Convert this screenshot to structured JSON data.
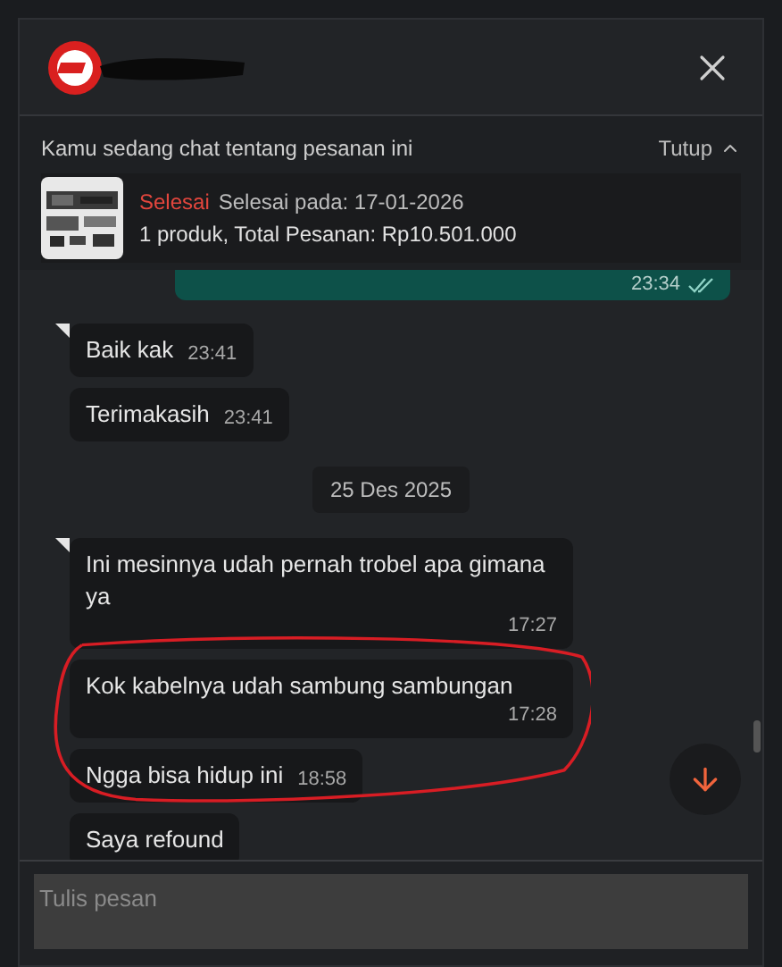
{
  "order_banner": {
    "title": "Kamu sedang chat tentang pesanan ini",
    "toggle": "Tutup",
    "expanded": true,
    "status": "Selesai",
    "completed": "Selesai pada: 17-01-2026",
    "summary": "1 produk, Total Pesanan: Rp10.501.000"
  },
  "messages": [
    {
      "kind": "outgoing",
      "time": "23:34",
      "read": true
    },
    {
      "kind": "incoming",
      "text": "Baik kak",
      "time": "23:41",
      "tail": true
    },
    {
      "kind": "incoming",
      "text": "Terimakasih",
      "time": "23:41",
      "tail": false
    },
    {
      "kind": "date",
      "text": "25 Des 2025"
    },
    {
      "kind": "incoming",
      "text": "Ini mesinnya udah pernah trobel apa gimana ya",
      "time": "17:27",
      "tail": true
    },
    {
      "kind": "incoming",
      "text": "Kok kabelnya udah sambung sambungan",
      "time": "17:28",
      "tail": false
    },
    {
      "kind": "incoming",
      "text": "Ngga bisa hidup ini",
      "time": "18:58",
      "tail": false
    },
    {
      "kind": "incoming",
      "text": "Saya refound",
      "tail": false
    }
  ],
  "composer": {
    "placeholder": "Tulis pesan"
  }
}
